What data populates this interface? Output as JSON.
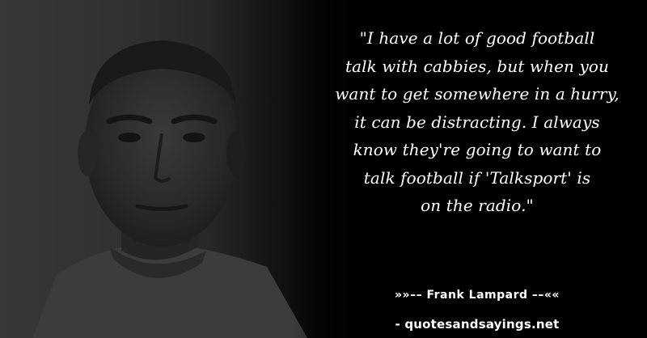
{
  "quote": {
    "text": "\"I have a lot of good football\ntalk with cabbies, but when you\nwant to get somewhere in a hurry,\nit can be distracting. I always\nknow they're going to want to\ntalk football if 'Talksport' is\non the radio.\""
  },
  "attribution": {
    "author_line": "»»–– Frank Lampard ––««"
  },
  "watermark": {
    "site": "- quotesandsayings.net"
  },
  "colors": {
    "background": "#000000",
    "text": "#ffffff"
  }
}
